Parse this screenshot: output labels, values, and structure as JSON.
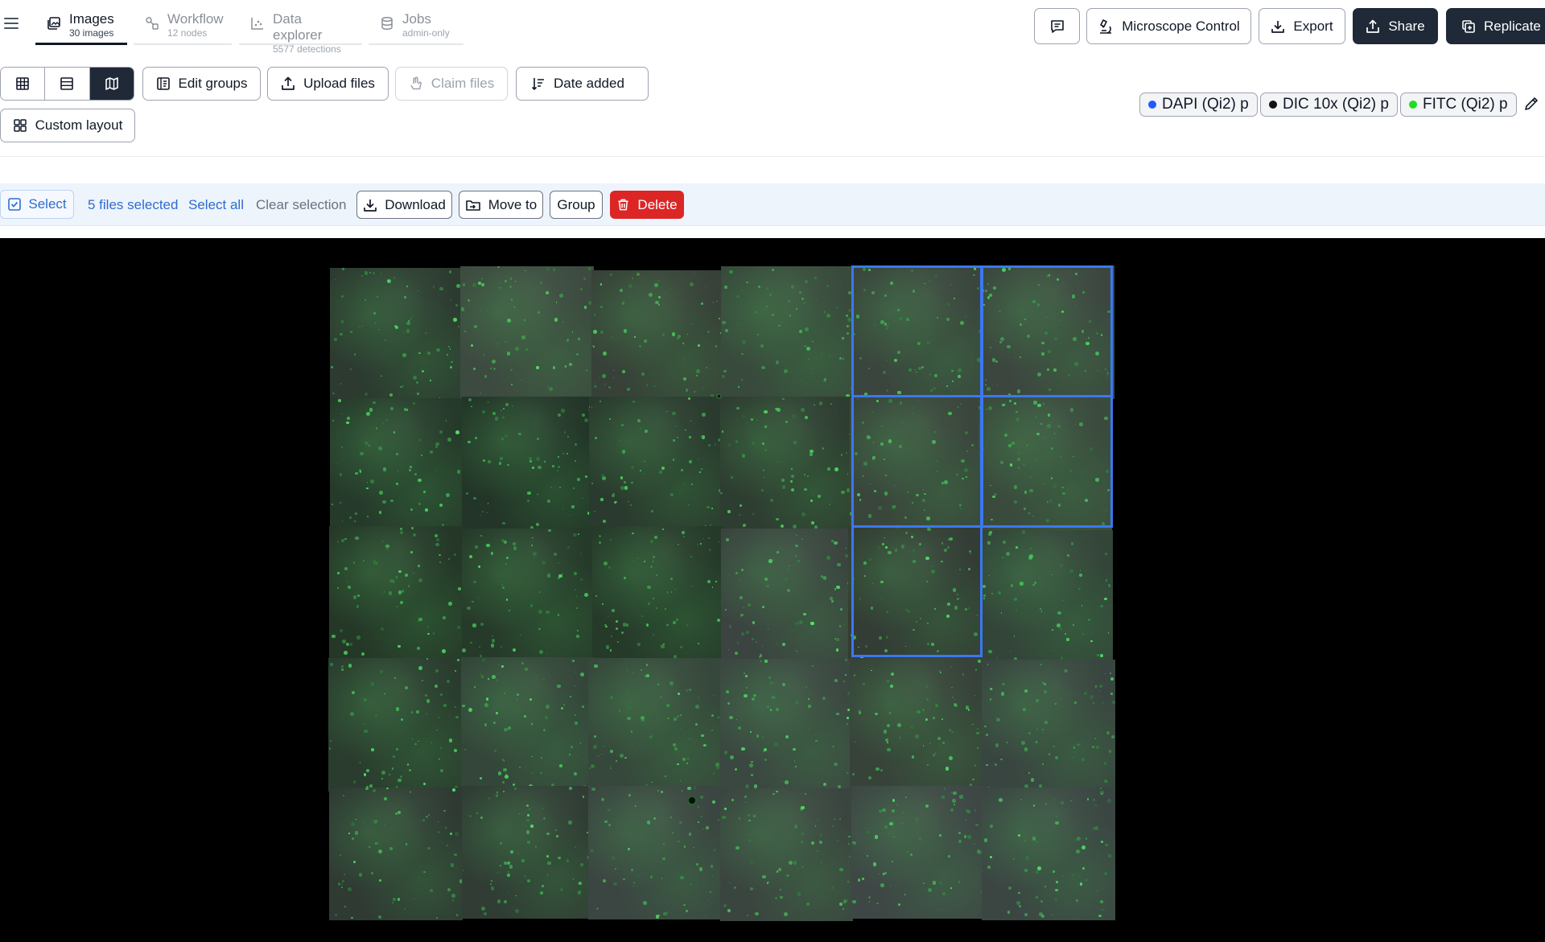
{
  "nav": {
    "tabs": [
      {
        "label": "Images",
        "sub": "30 images",
        "icon": "images-icon"
      },
      {
        "label": "Workflow",
        "sub": "12 nodes",
        "icon": "workflow-icon"
      },
      {
        "label": "Data explorer",
        "sub": "5577 detections",
        "icon": "scatter-chart-icon"
      },
      {
        "label": "Jobs",
        "sub": "admin-only",
        "icon": "database-icon"
      }
    ],
    "actions": {
      "comment_icon": "comment-icon",
      "microscope": "Microscope Control",
      "export": "Export",
      "share": "Share",
      "replicate": "Replicate"
    }
  },
  "toolbar": {
    "views": [
      "grid-view-icon",
      "list-view-icon",
      "map-view-icon"
    ],
    "active_view": "map",
    "edit_groups": "Edit groups",
    "upload_files": "Upload files",
    "claim_files": "Claim files",
    "sort": "Date added",
    "custom_layout": "Custom layout"
  },
  "channels": [
    {
      "label": "DAPI (Qi2) p",
      "color": "#1f5cff"
    },
    {
      "label": "DIC 10x (Qi2) p",
      "color": "#111111"
    },
    {
      "label": "FITC (Qi2) p",
      "color": "#22dd22"
    }
  ],
  "selection": {
    "select": "Select",
    "count": "5 files selected",
    "select_all": "Select all",
    "clear": "Clear selection",
    "download": "Download",
    "move_to": "Move to",
    "group": "Group",
    "delete": "Delete"
  },
  "mosaic": {
    "grid": "6x5",
    "selected_tiles": [
      [
        4,
        0
      ],
      [
        5,
        0
      ],
      [
        4,
        1
      ],
      [
        5,
        1
      ],
      [
        4,
        2
      ]
    ],
    "selection_color": "#3a78f2"
  }
}
